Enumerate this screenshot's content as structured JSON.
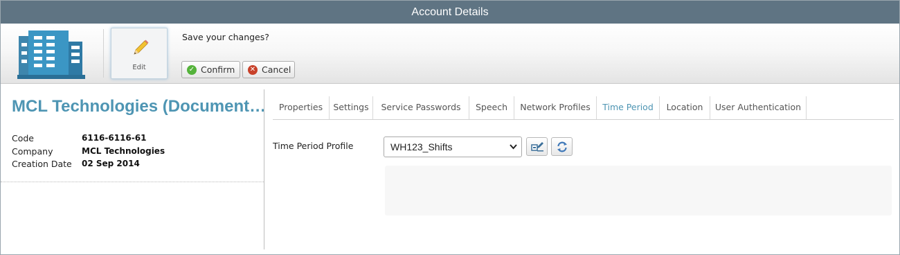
{
  "window": {
    "title": "Account Details"
  },
  "toolbar": {
    "edit_label": "Edit",
    "save_prompt": "Save your changes?",
    "confirm_label": "Confirm",
    "cancel_label": "Cancel"
  },
  "account": {
    "title": "MCL Technologies (Document…",
    "fields": [
      {
        "label": "Code",
        "value": "6116-6116-61"
      },
      {
        "label": "Company",
        "value": "MCL Technologies"
      },
      {
        "label": "Creation Date",
        "value": "02 Sep 2014"
      }
    ]
  },
  "tabs": [
    {
      "label": "Properties",
      "active": false
    },
    {
      "label": "Settings",
      "active": false
    },
    {
      "label": "Service Passwords",
      "active": false
    },
    {
      "label": "Speech",
      "active": false
    },
    {
      "label": "Network Profiles",
      "active": false
    },
    {
      "label": "Time Period",
      "active": true
    },
    {
      "label": "Location",
      "active": false
    },
    {
      "label": "User Authentication",
      "active": false
    }
  ],
  "time_period": {
    "field_label": "Time Period Profile",
    "selected": "WH123_Shifts"
  },
  "colors": {
    "accent": "#4e95b3",
    "titlebar": "#5f7483",
    "confirm": "#55b33b",
    "cancel": "#c8412a"
  },
  "icons": {
    "app_logo": "office-building-icon",
    "edit": "pencil-icon",
    "confirm": "check-circle-icon",
    "cancel": "x-circle-icon",
    "profile_edit": "edit-profile-icon",
    "refresh": "refresh-icon"
  }
}
